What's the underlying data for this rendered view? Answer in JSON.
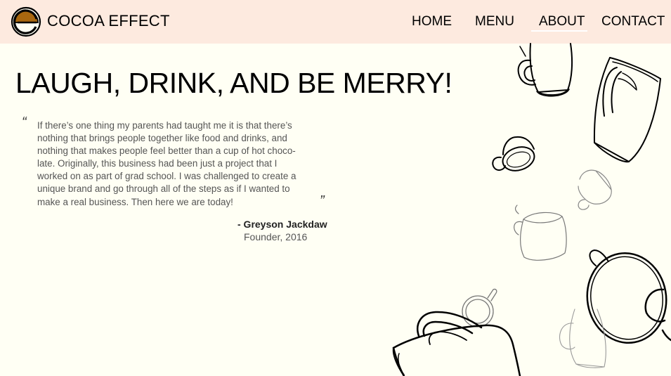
{
  "brand": {
    "name": "COCOA EFFECT",
    "logo_icon": "cocoa-c-logo-icon",
    "colors": {
      "logo_fill": "#a8670f",
      "header_bg": "#fdeadf",
      "page_bg": "#fffff4"
    }
  },
  "nav": {
    "items": [
      {
        "label": "HOME"
      },
      {
        "label": "MENU"
      },
      {
        "label": "ABOUT",
        "active": true
      },
      {
        "label": "CONTACT"
      }
    ]
  },
  "hero": {
    "title": "LAUGH, DRINK, AND BE MERRY!"
  },
  "testimonial": {
    "open_mark": "“",
    "close_mark": "”",
    "lines": [
      "If there’s one thing my parents had taught me it is that there’s",
      "nothing that brings people together like food and drinks, and",
      "nothing that makes people feel better than a cup of hot choco-",
      "late. Originally, this business had been just a project that I",
      "worked on as part of grad school. I was challenged to create a",
      "unique brand and go through all of the steps as if I wanted to",
      "make a real business. Then here we are today!"
    ],
    "author": "- Greyson Jackdaw",
    "role": "Founder, 2016"
  },
  "decoration": {
    "illustration_icon": "falling-mugs-icon"
  }
}
